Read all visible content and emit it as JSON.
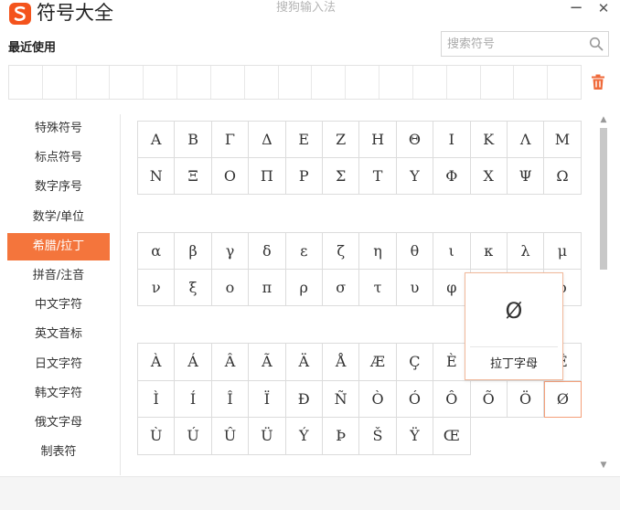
{
  "window": {
    "app_title": "符号大全",
    "subtitle": "搜狗输入法",
    "minimize_label": "−",
    "close_label": "✕"
  },
  "recent": {
    "label": "最近使用",
    "slots": 17
  },
  "search": {
    "placeholder": "搜索符号",
    "value": ""
  },
  "categories": [
    {
      "label": "特殊符号",
      "active": false
    },
    {
      "label": "标点符号",
      "active": false
    },
    {
      "label": "数字序号",
      "active": false
    },
    {
      "label": "数学/单位",
      "active": false
    },
    {
      "label": "希腊/拉丁",
      "active": true
    },
    {
      "label": "拼音/注音",
      "active": false
    },
    {
      "label": "中文字符",
      "active": false
    },
    {
      "label": "英文音标",
      "active": false
    },
    {
      "label": "日文字符",
      "active": false
    },
    {
      "label": "韩文字符",
      "active": false
    },
    {
      "label": "俄文字母",
      "active": false
    },
    {
      "label": "制表符",
      "active": false
    }
  ],
  "greek_upper": [
    "Α",
    "Β",
    "Γ",
    "Δ",
    "Ε",
    "Ζ",
    "Η",
    "Θ",
    "Ι",
    "Κ",
    "Λ",
    "Μ",
    "Ν",
    "Ξ",
    "Ο",
    "Π",
    "Ρ",
    "Σ",
    "Τ",
    "Υ",
    "Φ",
    "Χ",
    "Ψ",
    "Ω"
  ],
  "greek_lower": [
    "α",
    "β",
    "γ",
    "δ",
    "ε",
    "ζ",
    "η",
    "θ",
    "ι",
    "κ",
    "λ",
    "μ",
    "ν",
    "ξ",
    "ο",
    "π",
    "ρ",
    "σ",
    "τ",
    "υ",
    "φ",
    "",
    "",
    "ο"
  ],
  "latin": [
    "À",
    "Á",
    "Â",
    "Ã",
    "Ä",
    "Å",
    "Æ",
    "Ç",
    "È",
    "",
    "",
    "Ê",
    "Ì",
    "Í",
    "Î",
    "Ï",
    "Ð",
    "Ñ",
    "Ò",
    "Ó",
    "Ô",
    "Õ",
    "Ö",
    "Ø",
    "Ù",
    "Ú",
    "Û",
    "Ü",
    "Ý",
    "Þ",
    "Š",
    "Ÿ",
    "Œ"
  ],
  "selected_index": 23,
  "popup": {
    "char": "Ø",
    "label": "拉丁字母"
  },
  "colors": {
    "accent": "#f4753c",
    "grid_border": "#dcdcdc"
  },
  "icons": {
    "logo": "sogou-s-logo-icon",
    "search": "magnifier-icon",
    "trash": "trash-icon"
  }
}
